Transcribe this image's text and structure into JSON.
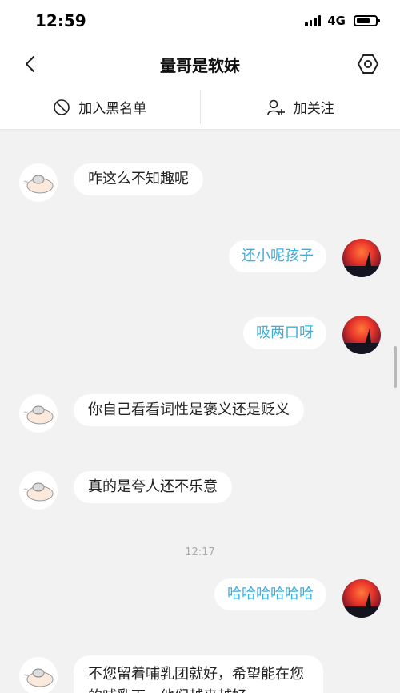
{
  "status": {
    "time": "12:59",
    "network": "4G"
  },
  "nav": {
    "title": "量哥是软妹"
  },
  "actions": {
    "block_label": "加入黑名单",
    "follow_label": "加关注"
  },
  "messages": [
    {
      "side": "left",
      "text": "咋这么不知趣呢"
    },
    {
      "side": "right",
      "text": "还小呢孩子"
    },
    {
      "side": "right",
      "text": "吸两口呀"
    },
    {
      "side": "left",
      "text": "你自己看看词性是褒义还是贬义"
    },
    {
      "side": "left",
      "text": "真的是夸人还不乐意"
    },
    {
      "side": "time",
      "text": "12:17"
    },
    {
      "side": "right",
      "text": "哈哈哈哈哈哈"
    },
    {
      "side": "left",
      "text": "不您留着哺乳团就好，希望能在您的哺乳下，他们越来越好"
    }
  ],
  "icons": {
    "back": "chevron-left-icon",
    "settings": "hexagon-settings-icon",
    "block": "block-icon",
    "follow": "add-user-icon"
  },
  "colors": {
    "accent": "#3ab0e0",
    "background": "#f2f2f2"
  }
}
